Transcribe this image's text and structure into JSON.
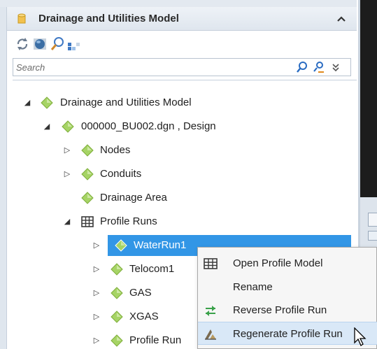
{
  "panel": {
    "title": "Drainage and Utilities Model",
    "collapse_glyph": "^"
  },
  "toolbar": {
    "buttons": [
      "refresh-icon",
      "sphere-model-icon",
      "zoom-icon",
      "grid-icon"
    ]
  },
  "search": {
    "placeholder": "Search",
    "value": ""
  },
  "tree": [
    {
      "label": "Drainage and Utilities Model",
      "expander": "◢",
      "icon": "diamond-model-icon",
      "depth": 0
    },
    {
      "label": "000000_BU002.dgn , Design",
      "expander": "◢",
      "icon": "diamond-model-icon",
      "depth": 1
    },
    {
      "label": "Nodes",
      "expander": "▷",
      "icon": "diamond-model-icon",
      "depth": 2
    },
    {
      "label": "Conduits",
      "expander": "▷",
      "icon": "diamond-model-icon",
      "depth": 2
    },
    {
      "label": "Drainage Area",
      "expander": "",
      "icon": "diamond-model-icon",
      "depth": 2
    },
    {
      "label": "Profile Runs",
      "expander": "◢",
      "icon": "grid-table-icon",
      "depth": 2
    },
    {
      "label": "WaterRun1",
      "expander": "▷",
      "icon": "diamond-model-icon",
      "depth": 3,
      "selected": true
    },
    {
      "label": "Telocom1",
      "expander": "▷",
      "icon": "diamond-model-icon",
      "depth": 3
    },
    {
      "label": "GAS",
      "expander": "▷",
      "icon": "diamond-model-icon",
      "depth": 3
    },
    {
      "label": "XGAS",
      "expander": "▷",
      "icon": "diamond-model-icon",
      "depth": 3
    },
    {
      "label": "Profile Run",
      "expander": "▷",
      "icon": "diamond-model-icon",
      "depth": 3
    }
  ],
  "context_menu": {
    "items": [
      {
        "label": "Open Profile Model",
        "icon": "grid-table-icon"
      },
      {
        "label": "Rename",
        "icon": ""
      },
      {
        "label": "Reverse Profile Run",
        "icon": "reverse-arrows-icon"
      },
      {
        "label": "Regenerate Profile Run",
        "icon": "regenerate-icon",
        "hover": true
      }
    ]
  },
  "colors": {
    "selection": "#3296e6",
    "diamond_green": "#8cc63f",
    "menu_hover": "#d9e8f7"
  }
}
